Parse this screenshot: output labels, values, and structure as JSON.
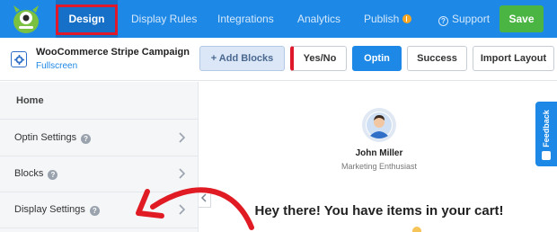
{
  "nav": {
    "items": [
      {
        "label": "Design",
        "active": true
      },
      {
        "label": "Display Rules"
      },
      {
        "label": "Integrations"
      },
      {
        "label": "Analytics"
      },
      {
        "label": "Publish"
      },
      {
        "label": "Support"
      }
    ],
    "save_label": "Save",
    "active_highlight_color": "#e0182b",
    "brand_color": "#1d88e5"
  },
  "campaign": {
    "title": "WooCommerce Stripe Campaign",
    "type": "Fullscreen"
  },
  "toolbar": {
    "add_blocks": "+ Add Blocks",
    "yes_no": "Yes/No",
    "optin": "Optin",
    "success": "Success",
    "import_layout": "Import Layout"
  },
  "sidebar": {
    "items": [
      {
        "label": "Home"
      },
      {
        "label": "Optin Settings"
      },
      {
        "label": "Blocks"
      },
      {
        "label": "Display Settings"
      }
    ]
  },
  "canvas": {
    "person_name": "John Miller",
    "person_role": "Marketing Enthusiast",
    "headline": "Hey there! You have items in your cart!"
  },
  "feedback_label": "Feedback",
  "icons": [
    "optinmonster-logo",
    "publish-alert-icon",
    "help-icon",
    "gear-icon",
    "question-icon",
    "chevron-right-icon",
    "chevron-left-icon",
    "avatar",
    "feedback-icon",
    "red-arrow"
  ]
}
